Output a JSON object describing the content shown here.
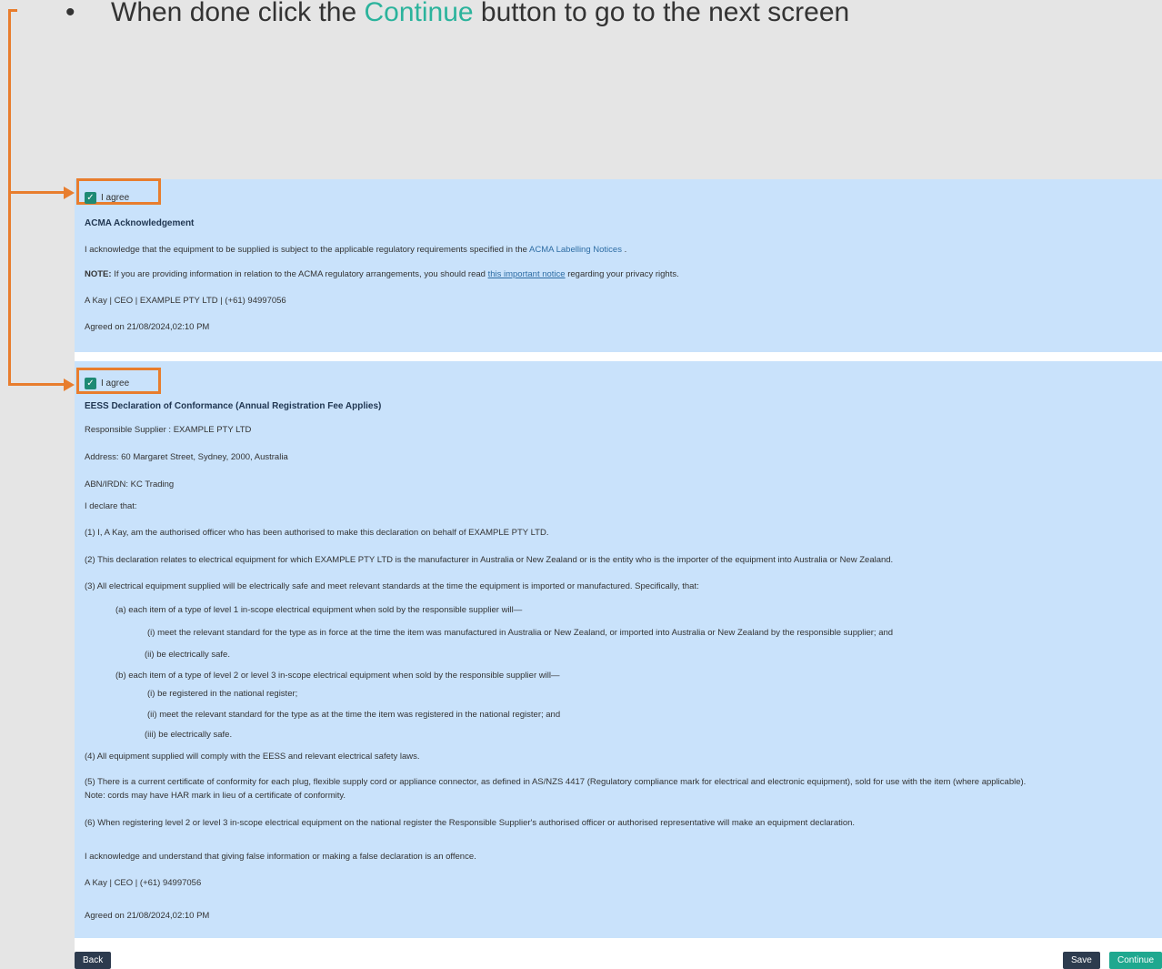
{
  "instruction": {
    "bullet": "•",
    "prefix": "When done click the ",
    "highlight": "Continue",
    "suffix": " button to go to the next screen"
  },
  "colors": {
    "accent": "#e87d2d",
    "panel": "#c9e2fb",
    "continue": "#1fa88f",
    "dark_button": "#2d3b4e"
  },
  "acma": {
    "agree_label": "I agree",
    "title": "ACMA Acknowledgement",
    "line1_pre": "I acknowledge that the equipment to be supplied is subject to the applicable regulatory requirements specified in the ",
    "line1_link": "ACMA Labelling Notices",
    "line1_post": " .",
    "note_label": "NOTE:",
    "note_pre": " If you are providing information in relation to the ACMA regulatory arrangements, you should read ",
    "note_link": "this important notice",
    "note_post": " regarding your privacy rights.",
    "signer": "A Kay  |  CEO |  EXAMPLE PTY LTD  |  (+61) 94997056",
    "agreed_on": "Agreed on 21/08/2024,02:10 PM"
  },
  "eess": {
    "agree_label": "I agree",
    "title": "EESS Declaration of Conformance (Annual Registration Fee Applies)",
    "supplier": "Responsible Supplier :  EXAMPLE PTY LTD",
    "address": "Address: 60 Margaret Street, Sydney, 2000, Australia",
    "abn": "ABN/IRDN: KC Trading",
    "declare": "I declare that:",
    "p1": "(1) I, A Kay, am the authorised officer who has been authorised to make this declaration on behalf of  EXAMPLE PTY LTD.",
    "p2": "(2) This declaration relates to electrical equipment for which  EXAMPLE PTY LTD is the manufacturer in Australia or New Zealand or is the entity who is the importer of the equipment into Australia or New Zealand.",
    "p3": "(3) All electrical equipment supplied will be electrically safe and meet relevant standards at the time the equipment is imported or manufactured. Specifically, that:",
    "p3a": "(a) each item of a type of level 1 in-scope electrical equipment when sold by the responsible supplier will—",
    "p3a_i": "(i) meet the relevant standard for the type as in force at the time the item was manufactured in Australia or New Zealand, or imported into Australia or New Zealand by the responsible supplier; and",
    "p3a_ii": "(ii) be electrically safe.",
    "p3b": "(b) each item of a type of level 2 or level 3 in-scope electrical equipment when sold by the responsible supplier will—",
    "p3b_i": "(i) be registered in the national register;",
    "p3b_ii": "(ii) meet the relevant standard for the type as at the time the item was registered in the national register; and",
    "p3b_iii": "(iii) be electrically safe.",
    "p4": "(4) All equipment supplied will comply with the EESS and relevant electrical safety laws.",
    "p5": "(5) There is a current certificate of conformity for each plug, flexible supply cord or appliance connector, as defined in AS/NZS 4417 (Regulatory compliance mark for electrical and electronic equipment), sold for use with the item (where applicable).",
    "p5_note": "Note: cords may have HAR mark in lieu of a certificate of conformity.",
    "p6": "(6) When registering level 2 or level 3 in-scope electrical equipment on the national register the Responsible Supplier's authorised officer or authorised representative will make an equipment declaration.",
    "ack": "I acknowledge and understand that giving false information or making a false declaration is an offence.",
    "signer": "A Kay   | CEO  |  (+61) 94997056",
    "agreed_on": "Agreed on 21/08/2024,02:10 PM"
  },
  "footer": {
    "back": "Back",
    "save": "Save",
    "continue": "Continue"
  }
}
